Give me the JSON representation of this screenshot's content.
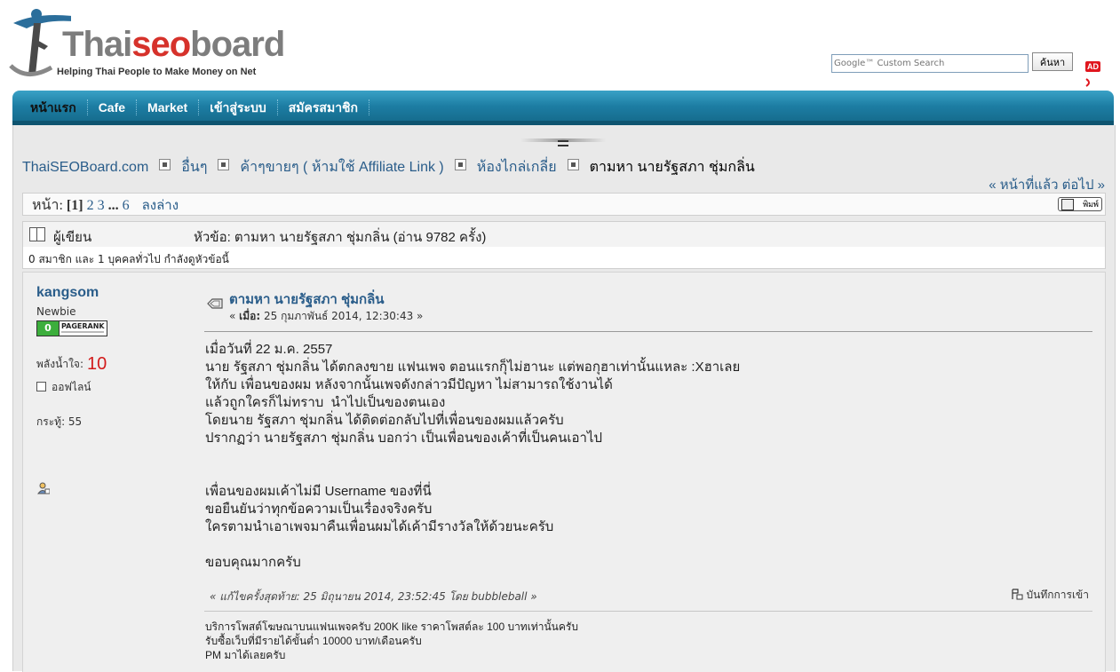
{
  "header": {
    "logo_word": {
      "part1": "haiseo",
      "part2": "",
      "part3": "board"
    },
    "logo_word_pre": "T",
    "logo_tagline": "Helping Thai People to Make Money on Net",
    "search_placeholder": "Google™ Custom Search",
    "search_button": "ค้นหา",
    "ad_badge": "AD"
  },
  "nav": {
    "items": [
      "หน้าแรก",
      "Cafe",
      "Market",
      "เข้าสู่ระบบ",
      "สมัครสมาชิก"
    ],
    "active_index": 0
  },
  "breadcrumb": {
    "items": [
      "ThaiSEOBoard.com",
      "อื่นๆ",
      "ค้าๆขายๆ ( ห้ามใช้ Affiliate Link )",
      "ห้องไกล่เกลี่ย",
      "ตามหา นายรัฐสภา ชุ่มกลิ่น"
    ]
  },
  "prev_next": "« หน้าที่แล้ว ต่อไป »",
  "pagination": {
    "label": "หน้า:",
    "current": "[1]",
    "pages": [
      "2",
      "3"
    ],
    "ellipsis": "...",
    "last": "6",
    "goto_bottom": "ลงล่าง"
  },
  "print_button": "พิมพ์",
  "topic_header": {
    "author_label": "ผู้เขียน",
    "topic_label": "หัวข้อ: ตามหา นายรัฐสภา ชุ่มกลิ่น  (อ่าน 9782 ครั้ง)"
  },
  "viewers_text": "0 สมาชิก และ 1 บุคคลทั่วไป กำลังดูหัวข้อนี้",
  "post": {
    "poster": {
      "name": "kangsom",
      "rank": "Newbie",
      "pagerank": "0",
      "pagerank_label": "PAGERANK",
      "karma_label": "พลังน้ำใจ:",
      "karma_value": "10",
      "status": "ออฟไลน์",
      "posts": "กระทู้: 55"
    },
    "subject": "ตามหา นายรัฐสภา ชุ่มกลิ่น",
    "date": "« เมื่อ: 25 กุมภาพันธ์ 2014, 12:30:43 »",
    "date_prefix": "« ",
    "date_label": "เมื่อ:",
    "date_value": " 25 กุมภาพันธ์ 2014, 12:30:43 »",
    "body": "เมื่อวันที่ 22 ม.ค. 2557\nนาย รัฐสภา ชุ่มกลิ่น ได้ตกลงขาย แฟนเพจ ตอนแรกกุ็ไม่ฮานะ แต่พอกุฮาเท่านั้นแหละ :Xฮาเลย\nให้กับ เพื่อนของผม หลังจากนั้นเพจดังกล่าวมีปัญหา ไม่สามารถใช้งานได้\nแล้วถูกใครก็ไม่ทราบ  นำไปเป็นของตนเอง\nโดยนาย รัฐสภา ชุ่มกลิ่น ได้ติดต่อกลับไปที่เพื่อนของผมแล้วครับ\nปรากฏว่า นายรัฐสภา ชุ่มกลิ่น บอกว่า เป็นเพื่อนของเค้าที่เป็นคนเอาไป\n\n\nเพื่อนของผมเค้าไม่มี Username ของที่นี่\nขอยืนยันว่าทุกข้อความเป็นเรื่องจริงครับ\nใครตามนำเอาเพจมาคืนเพื่อนผมได้เค้ามีรางวัลให้ด้วยนะครับ\n\nขอบคุณมากครับ",
    "modified": "« แก้ไขครั้งสุดท้าย: 25 มิถุนายน 2014, 23:52:45 โดย bubbleball »",
    "ip_log": "บันทึกการเข้า",
    "signature": "บริการโพสต์โฆษณาบนแฟนเพจครับ 200K like ราคาโพสต์ละ 100 บาทเท่านั้นครับ\nรับซื้อเว็บที่มีรายได้ขั้นต่ำ 10000 บาท/เดือนครับ\nPM มาได้เลยครับ"
  },
  "colors": {
    "nav_gradient_top": "#3aa1c6",
    "nav_gradient_bottom": "#146889",
    "link": "#2a5d8a",
    "karma_value": "#d21b1b",
    "pagerank_green": "#3cae3c"
  }
}
